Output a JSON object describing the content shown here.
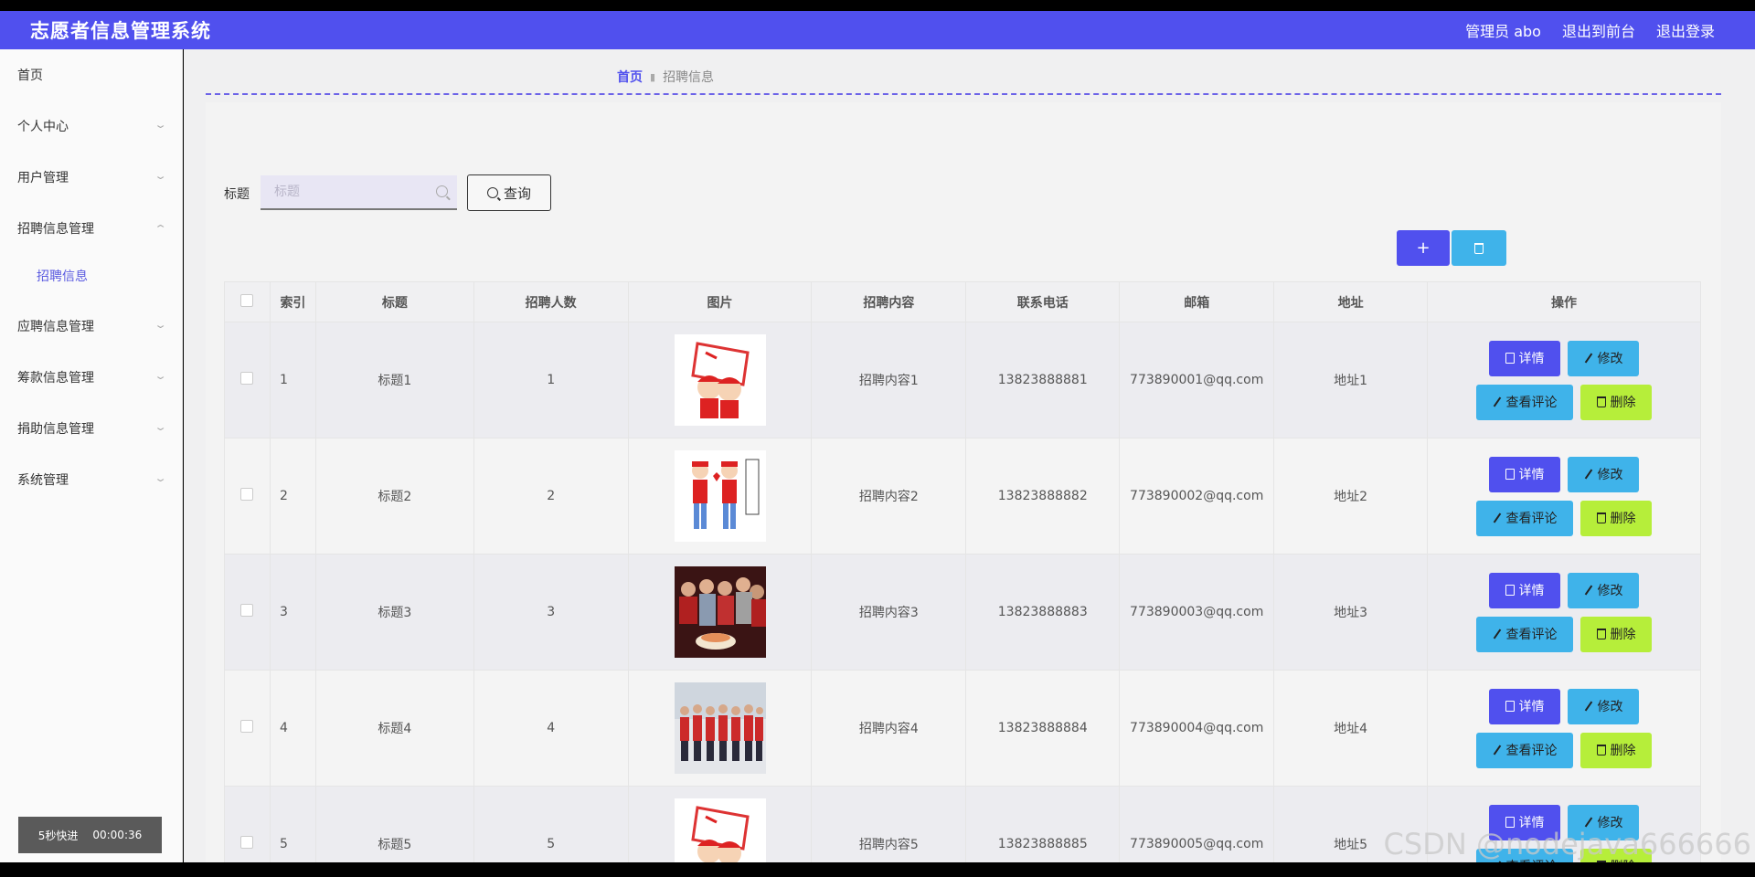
{
  "header": {
    "title": "志愿者信息管理系统",
    "admin_label": "管理员 abo",
    "front_link": "退出到前台",
    "logout_link": "退出登录"
  },
  "sidebar": {
    "items": [
      {
        "label": "首页"
      },
      {
        "label": "个人中心"
      },
      {
        "label": "用户管理"
      },
      {
        "label": "招聘信息管理",
        "expanded": true
      },
      {
        "label": "招聘信息",
        "sub": true,
        "active": true
      },
      {
        "label": "应聘信息管理"
      },
      {
        "label": "筹款信息管理"
      },
      {
        "label": "捐助信息管理"
      },
      {
        "label": "系统管理"
      }
    ]
  },
  "breadcrumb": {
    "home": "首页",
    "current": "招聘信息"
  },
  "search": {
    "label": "标题",
    "placeholder": "标题",
    "value": "",
    "button": "查询"
  },
  "toolbar": {
    "add_icon": "+",
    "delete_icon": "trash-icon"
  },
  "table": {
    "columns": [
      "索引",
      "标题",
      "招聘人数",
      "图片",
      "招聘内容",
      "联系电话",
      "邮箱",
      "地址",
      "操作"
    ],
    "rows": [
      {
        "index": "1",
        "title": "标题1",
        "count": "1",
        "content": "招聘内容1",
        "phone": "13823888881",
        "email": "773890001@qq.com",
        "address": "地址1"
      },
      {
        "index": "2",
        "title": "标题2",
        "count": "2",
        "content": "招聘内容2",
        "phone": "13823888882",
        "email": "773890002@qq.com",
        "address": "地址2"
      },
      {
        "index": "3",
        "title": "标题3",
        "count": "3",
        "content": "招聘内容3",
        "phone": "13823888883",
        "email": "773890003@qq.com",
        "address": "地址3"
      },
      {
        "index": "4",
        "title": "标题4",
        "count": "4",
        "content": "招聘内容4",
        "phone": "13823888884",
        "email": "773890004@qq.com",
        "address": "地址4"
      },
      {
        "index": "5",
        "title": "标题5",
        "count": "5",
        "content": "招聘内容5",
        "phone": "13823888885",
        "email": "773890005@qq.com",
        "address": "地址5"
      }
    ],
    "actions": {
      "detail": "详情",
      "edit": "修改",
      "comment": "查看评论",
      "delete": "删除"
    }
  },
  "overlay": {
    "speed": "5秒快进",
    "time": "00:00:36",
    "watermark": "CSDN @nodejava666666"
  },
  "colors": {
    "primary": "#5050ee",
    "info": "#3fb3ea",
    "danger_alt": "#b6ee3a"
  }
}
